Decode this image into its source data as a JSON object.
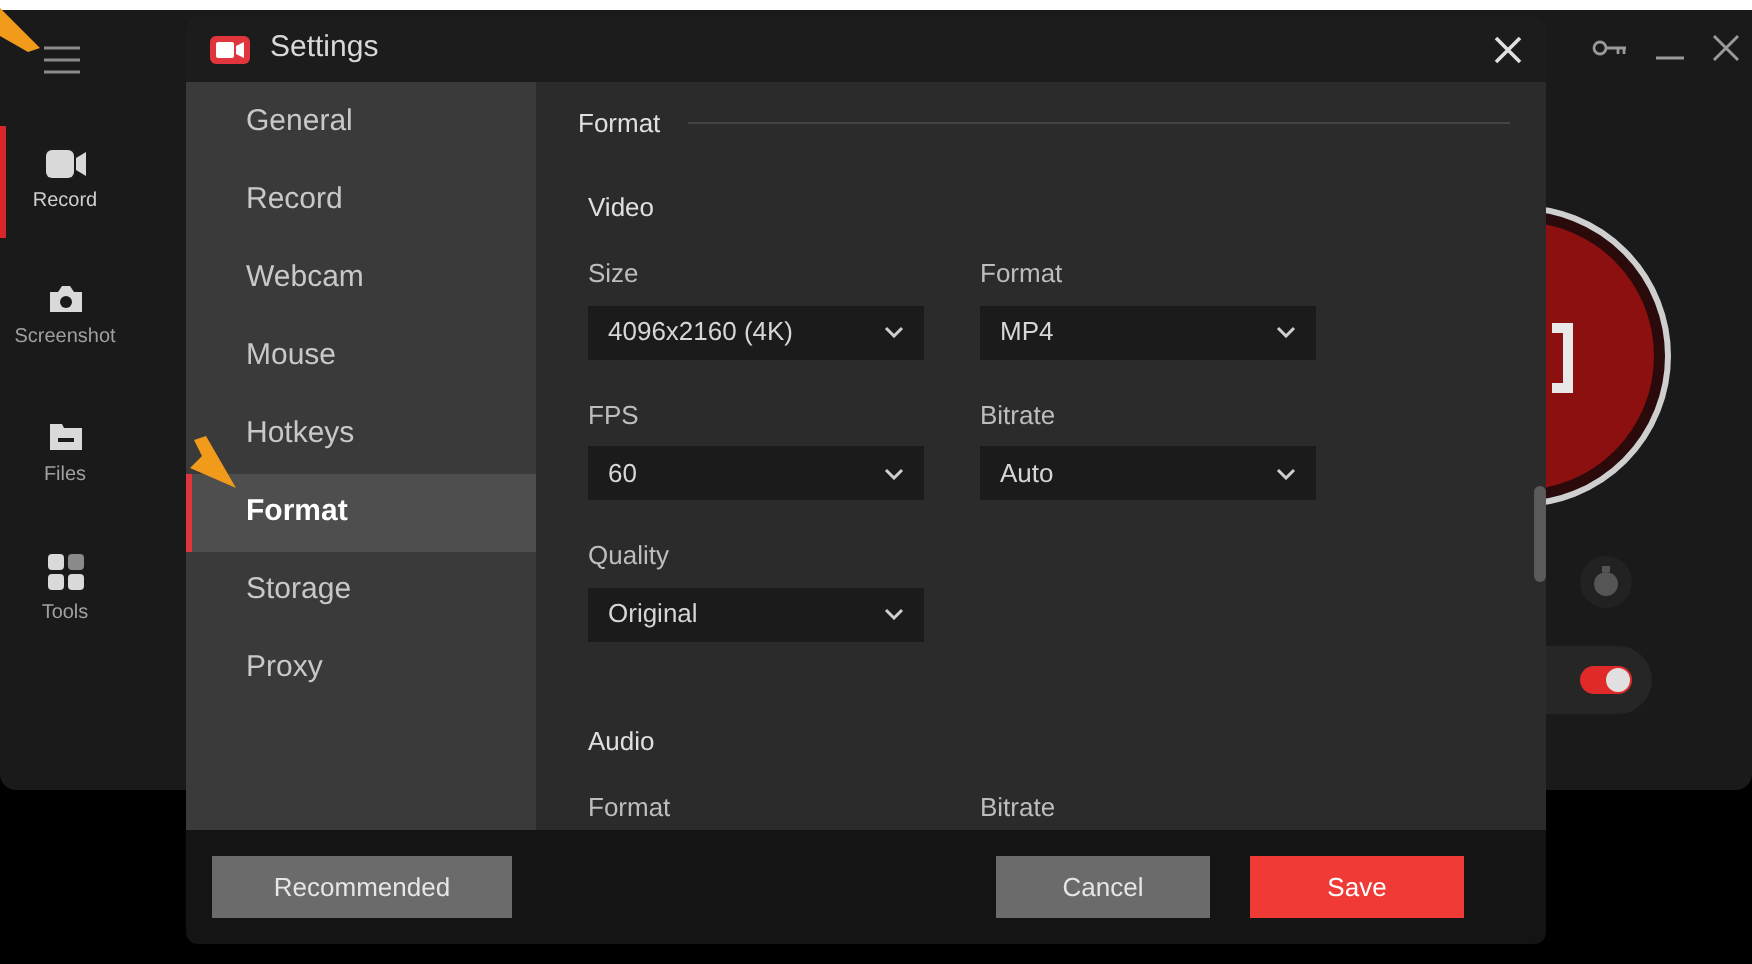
{
  "app_rail": [
    {
      "label": "Record",
      "kind": "record",
      "selected": true
    },
    {
      "label": "Screenshot",
      "kind": "camera",
      "selected": false
    },
    {
      "label": "Files",
      "kind": "folder",
      "selected": false
    },
    {
      "label": "Tools",
      "kind": "grid",
      "selected": false
    }
  ],
  "recording_toggle": {
    "on": true
  },
  "dialog": {
    "title": "Settings",
    "sidebar": [
      {
        "label": "General",
        "selected": false
      },
      {
        "label": "Record",
        "selected": false
      },
      {
        "label": "Webcam",
        "selected": false
      },
      {
        "label": "Mouse",
        "selected": false
      },
      {
        "label": "Hotkeys",
        "selected": false
      },
      {
        "label": "Format",
        "selected": true
      },
      {
        "label": "Storage",
        "selected": false
      },
      {
        "label": "Proxy",
        "selected": false
      }
    ],
    "section_title": "Format",
    "groups": [
      {
        "title": "Video",
        "fields": [
          {
            "label": "Size",
            "value": "4096x2160 (4K)"
          },
          {
            "label": "Format",
            "value": "MP4"
          },
          {
            "label": "FPS",
            "value": "60"
          },
          {
            "label": "Bitrate",
            "value": "Auto"
          },
          {
            "label": "Quality",
            "value": "Original"
          }
        ]
      },
      {
        "title": "Audio",
        "fields": [
          {
            "label": "Format"
          },
          {
            "label": "Bitrate"
          }
        ]
      }
    ],
    "buttons": [
      {
        "label": "Recommended",
        "kind": "secondary"
      },
      {
        "label": "Cancel",
        "kind": "secondary"
      },
      {
        "label": "Save",
        "kind": "primary"
      }
    ]
  }
}
